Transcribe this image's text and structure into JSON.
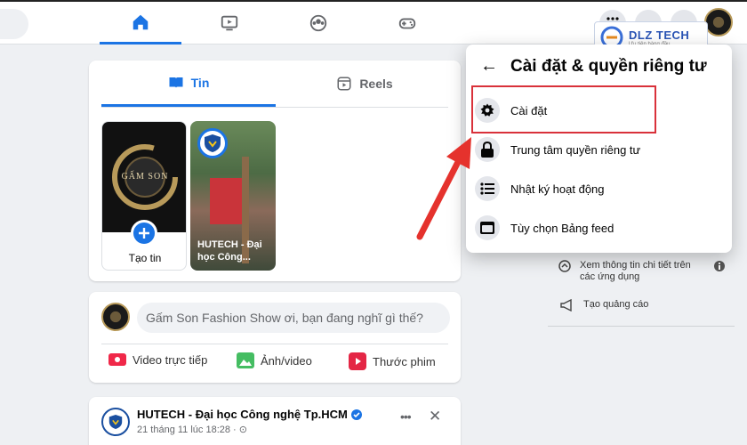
{
  "nav": {
    "tabs": [
      {
        "name": "home-icon",
        "active": true
      },
      {
        "name": "video-icon"
      },
      {
        "name": "groups-icon"
      },
      {
        "name": "gaming-icon"
      }
    ]
  },
  "feed": {
    "story_tabs": [
      {
        "label": "Tin",
        "icon": "book-icon"
      },
      {
        "label": "Reels",
        "icon": "reels-icon"
      }
    ],
    "create_story_label": "Tạo tin",
    "brand_text": "GẤM SON",
    "story_card_label": "HUTECH - Đại học Công...",
    "composer_placeholder": "Gấm Son Fashion Show ơi, bạn đang nghĩ gì thế?",
    "composer_actions": [
      {
        "label": "Video trực tiếp",
        "color": "#f02849"
      },
      {
        "label": "Ảnh/video",
        "color": "#45bd62"
      },
      {
        "label": "Thước phim",
        "color": "#e42645"
      }
    ],
    "post": {
      "author": "HUTECH - Đại học Công nghệ Tp.HCM",
      "time": "21 tháng 11 lúc 18:28 · ⊙",
      "more_symbol": "•••",
      "close_symbol": "✕"
    }
  },
  "menu": {
    "back_symbol": "←",
    "title": "Cài đặt & quyền riêng tư",
    "items": [
      {
        "label": "Cài đặt",
        "icon": "gear-icon"
      },
      {
        "label": "Trung tâm quyền riêng tư",
        "icon": "lock-icon"
      },
      {
        "label": "Nhật ký hoạt động",
        "icon": "list-icon"
      },
      {
        "label": "Tùy chọn Bảng feed",
        "icon": "feed-icon"
      }
    ]
  },
  "sidebar": {
    "links": [
      {
        "label": "Xem thông tin chi tiết trên các ứng dụng"
      },
      {
        "label": "Tạo quảng cáo"
      }
    ]
  },
  "watermark": {
    "text": "DLZ TECH",
    "subtext": "Ưu tiên hàng đầu"
  },
  "colors": {
    "accent": "#1b74e4",
    "highlight": "#d9313a",
    "arrow": "#e5322d"
  }
}
